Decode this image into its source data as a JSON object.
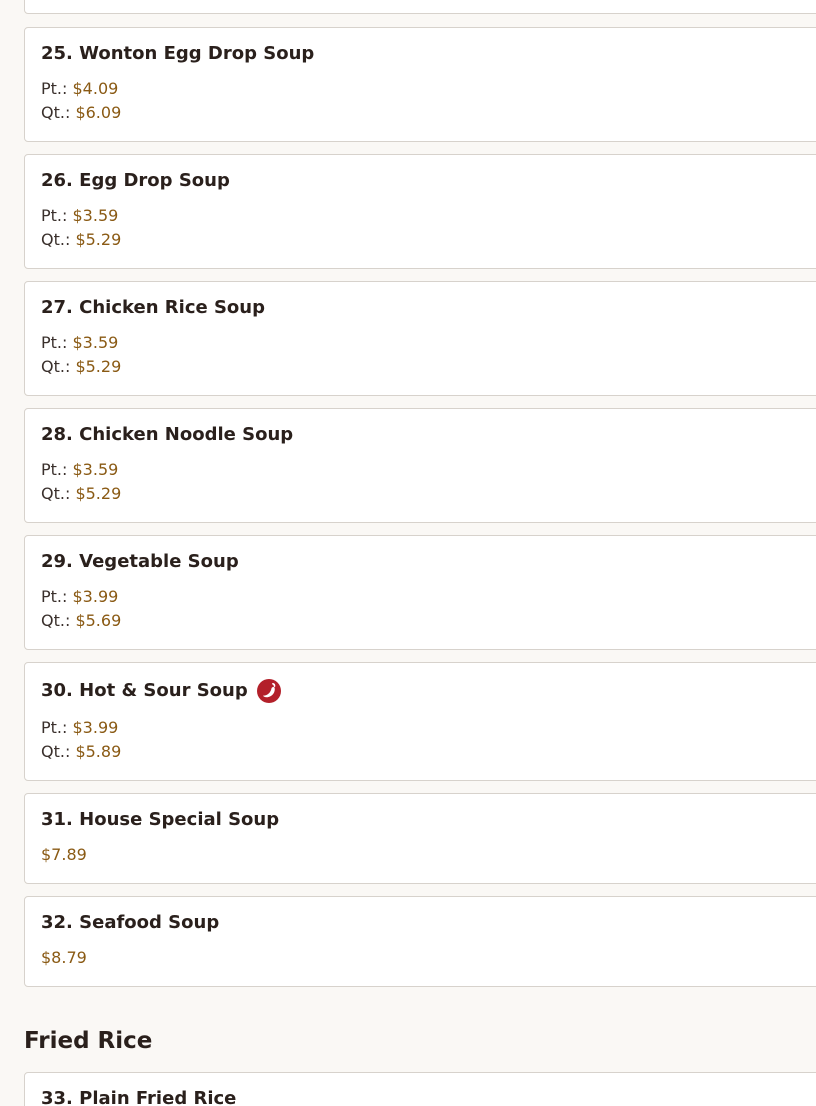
{
  "items": [
    {
      "title": "25. Wonton Egg Drop Soup",
      "prices": [
        {
          "label": "Pt.:",
          "value": "$4.09"
        },
        {
          "label": "Qt.:",
          "value": "$6.09"
        }
      ]
    },
    {
      "title": "26. Egg Drop Soup",
      "prices": [
        {
          "label": "Pt.:",
          "value": "$3.59"
        },
        {
          "label": "Qt.:",
          "value": "$5.29"
        }
      ]
    },
    {
      "title": "27. Chicken Rice Soup",
      "prices": [
        {
          "label": "Pt.:",
          "value": "$3.59"
        },
        {
          "label": "Qt.:",
          "value": "$5.29"
        }
      ]
    },
    {
      "title": "28. Chicken Noodle Soup",
      "prices": [
        {
          "label": "Pt.:",
          "value": "$3.59"
        },
        {
          "label": "Qt.:",
          "value": "$5.29"
        }
      ]
    },
    {
      "title": "29. Vegetable Soup",
      "prices": [
        {
          "label": "Pt.:",
          "value": "$3.99"
        },
        {
          "label": "Qt.:",
          "value": "$5.69"
        }
      ]
    },
    {
      "title": "30. Hot & Sour Soup",
      "spicy_icon": "chili-pepper-icon",
      "prices": [
        {
          "label": "Pt.:",
          "value": "$3.99"
        },
        {
          "label": "Qt.:",
          "value": "$5.89"
        }
      ]
    },
    {
      "title": "31. House Special Soup",
      "price": "$7.89"
    },
    {
      "title": "32. Seafood Soup",
      "price": "$8.79"
    }
  ],
  "section": {
    "title": "Fried Rice"
  },
  "next_item": {
    "title": "33. Plain Fried Rice"
  },
  "colors": {
    "price": "#8a5a14",
    "spicy_badge": "#b3202a",
    "card_border": "#d7d2cc",
    "background": "#faf8f5"
  }
}
